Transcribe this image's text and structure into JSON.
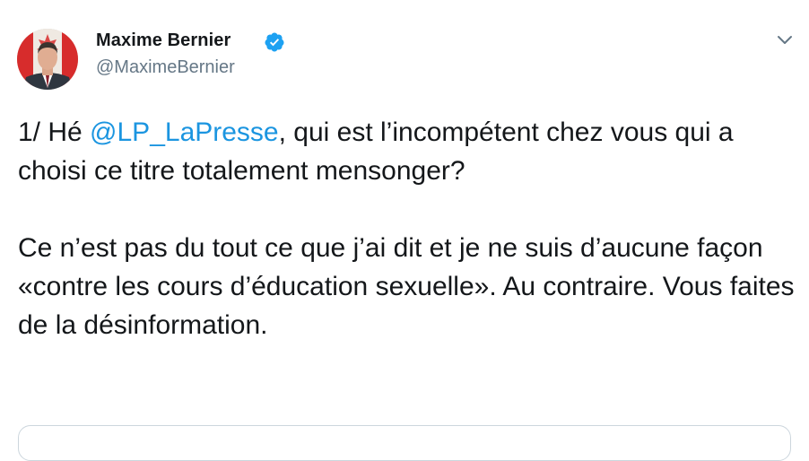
{
  "author": {
    "name": "Maxime Bernier",
    "handle": "@MaximeBernier",
    "verified": true
  },
  "colors": {
    "link": "#1b95e0",
    "verified_badge": "#1da1f2",
    "handle": "#657786",
    "text": "#14171a"
  },
  "icons": {
    "verified": "verified-badge-icon",
    "menu": "chevron-down-icon"
  },
  "tweet": {
    "line1_prefix": "1/ Hé ",
    "mention": "@LP_LaPresse",
    "line1_suffix": ", qui est l’incompétent chez vous qui a choisi ce titre totalement mensonger?",
    "paragraph2": "Ce n’est pas du tout ce que j’ai dit et je ne suis d’aucune façon «contre les cours d’éducation sexuelle». Au contraire. Vous faites de la désinformation."
  }
}
